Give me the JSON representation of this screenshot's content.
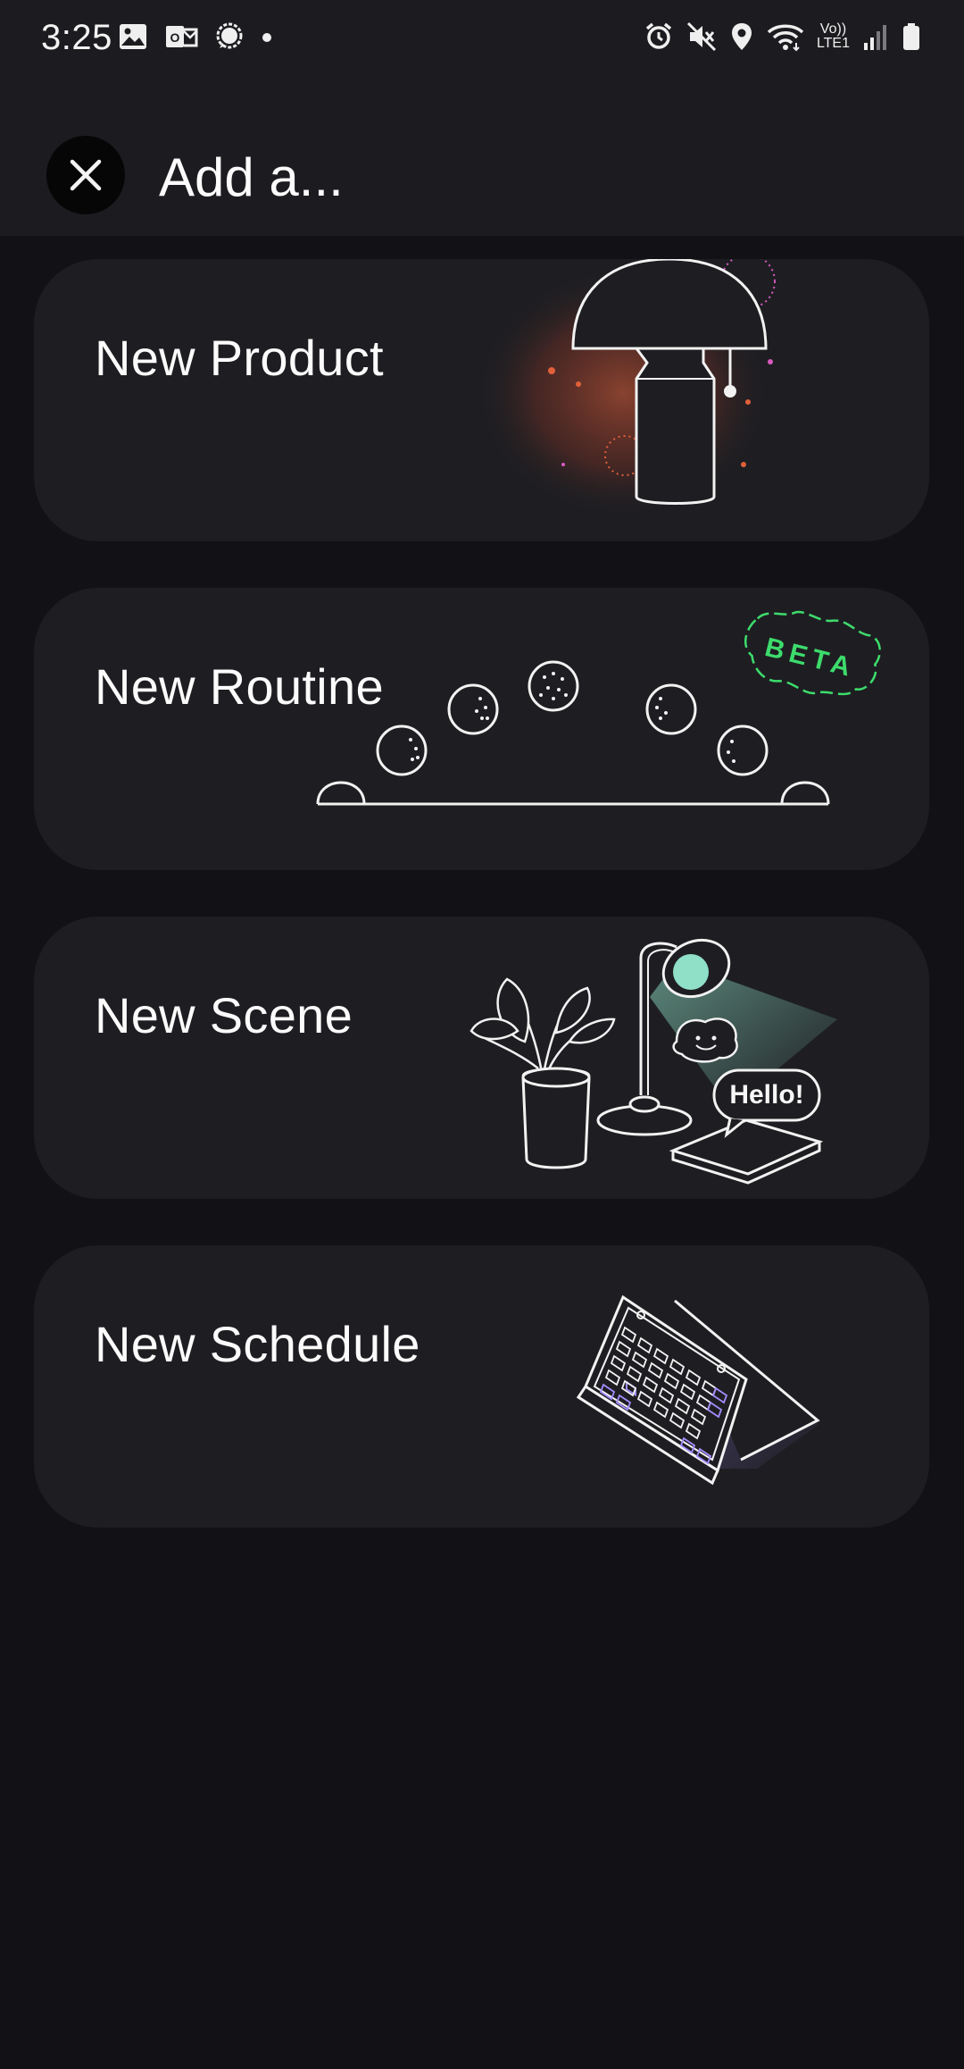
{
  "status_bar": {
    "time": "3:25",
    "network_label_top": "Vo))",
    "network_label_bottom": "LTE1",
    "left_icons": [
      "image-icon",
      "outlook-icon",
      "signal-messenger-icon",
      "dot-icon"
    ],
    "right_icons": [
      "alarm-icon",
      "mute-icon",
      "location-icon",
      "wifi-icon",
      "cell-signal-icon",
      "battery-icon"
    ]
  },
  "header": {
    "title": "Add a...",
    "close_icon": "close-icon"
  },
  "cards": [
    {
      "label": "New Product",
      "illustration": "lamp-illustration"
    },
    {
      "label": "New Routine",
      "illustration": "moon-phases-illustration",
      "badge": "BETA"
    },
    {
      "label": "New Scene",
      "illustration": "desk-lamp-plant-illustration",
      "bubble": "Hello!"
    },
    {
      "label": "New Schedule",
      "illustration": "calendar-illustration"
    }
  ],
  "colors": {
    "background": "#121216",
    "header": "#1c1c20",
    "card": "#1e1e22",
    "beta_green": "#3ddc6c",
    "accent_orange": "#e0603a",
    "accent_mint": "#8fe0c6"
  }
}
